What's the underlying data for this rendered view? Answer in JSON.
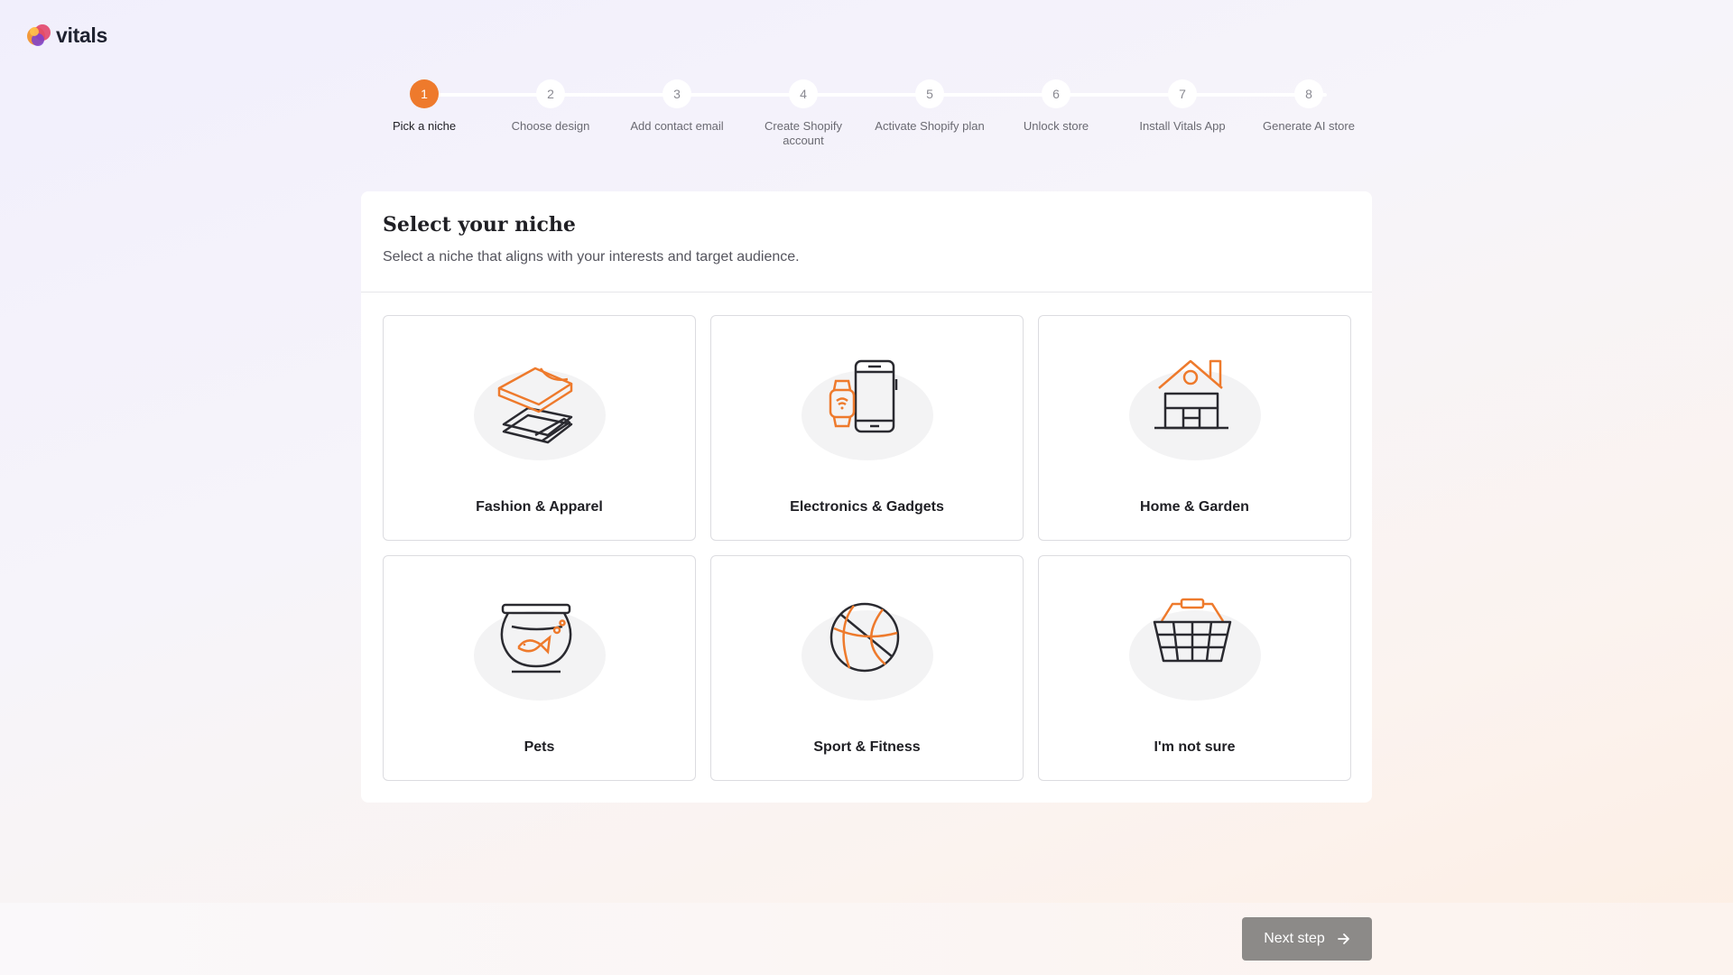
{
  "brand": {
    "name": "vitals"
  },
  "stepper": {
    "steps": [
      {
        "number": "1",
        "label": "Pick a niche",
        "active": true
      },
      {
        "number": "2",
        "label": "Choose design"
      },
      {
        "number": "3",
        "label": "Add contact email"
      },
      {
        "number": "4",
        "label": "Create Shopify account"
      },
      {
        "number": "5",
        "label": "Activate Shopify plan"
      },
      {
        "number": "6",
        "label": "Unlock store"
      },
      {
        "number": "7",
        "label": "Install Vitals App"
      },
      {
        "number": "8",
        "label": "Generate AI store"
      }
    ]
  },
  "main": {
    "title": "Select your niche",
    "subtitle": "Select a niche that aligns with your interests and target audience.",
    "niches": [
      {
        "label": "Fashion & Apparel",
        "icon": "wallet-icon"
      },
      {
        "label": "Electronics & Gadgets",
        "icon": "phone-watch-icon"
      },
      {
        "label": "Home & Garden",
        "icon": "house-icon"
      },
      {
        "label": "Pets",
        "icon": "fishbowl-icon"
      },
      {
        "label": "Sport & Fitness",
        "icon": "basketball-icon"
      },
      {
        "label": "I'm not sure",
        "icon": "basket-icon"
      }
    ]
  },
  "footer": {
    "next_label": "Next step"
  },
  "colors": {
    "accent": "#ee7a2c",
    "dark": "#2a2a30",
    "button": "#8c8a88"
  }
}
